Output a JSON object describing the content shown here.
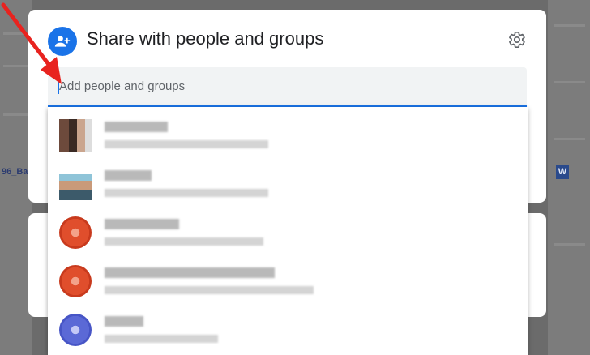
{
  "background": {
    "left_link": "96_Ba",
    "right_badge": "W"
  },
  "dialog": {
    "title": "Share with people and groups",
    "input_placeholder": "Add people and groups",
    "input_value": ""
  },
  "suggestions": [
    {
      "avatar": "photo-avatar"
    },
    {
      "avatar": "photo-avatar"
    },
    {
      "avatar": "initial-avatar-red"
    },
    {
      "avatar": "initial-avatar-red"
    },
    {
      "avatar": "initial-avatar-blue"
    }
  ],
  "colors": {
    "accent": "#1a73e8",
    "annotation_arrow": "#e8231f"
  }
}
